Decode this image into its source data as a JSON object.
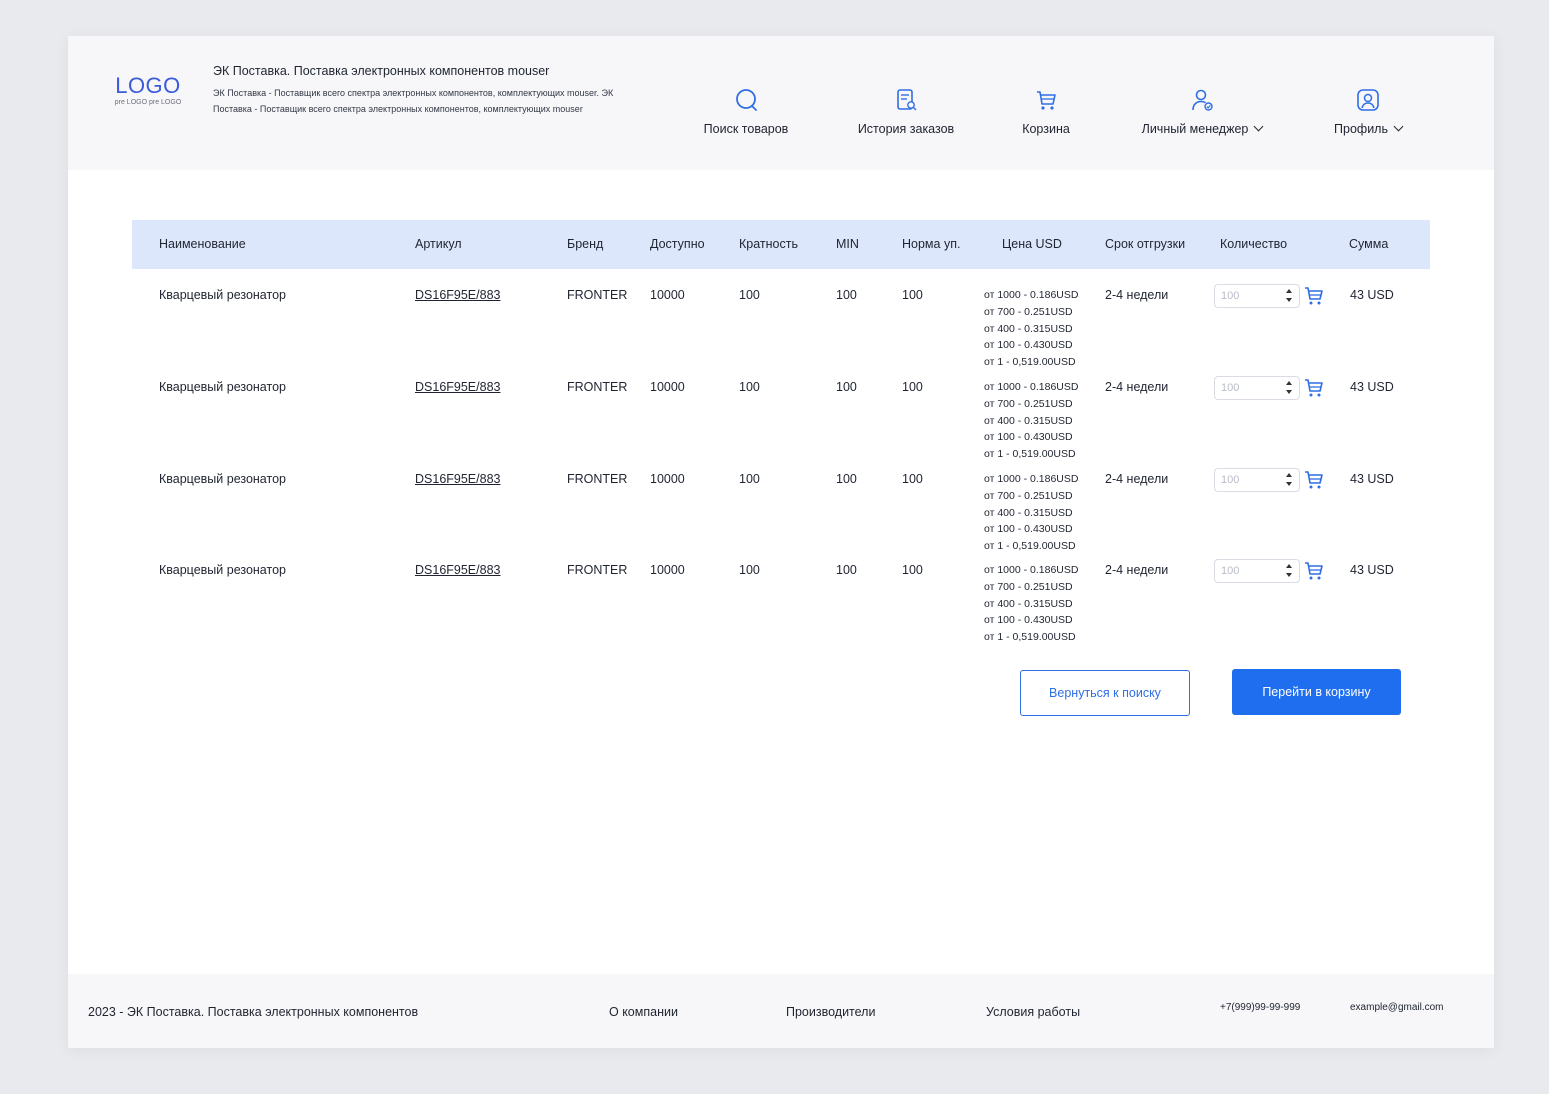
{
  "header": {
    "logo": "LOGO",
    "logo_sub": "pre LOGO pre LOGO",
    "title": "ЭК Поставка. Поставка электронных компонентов mouser",
    "description": "ЭК Поставка - Поставщик всего спектра электронных компонентов, комплектующих mouser. ЭК Поставка - Поставщик всего спектра электронных компонентов, комплектующих mouser"
  },
  "nav": {
    "search": "Поиск товаров",
    "history": "История заказов",
    "cart": "Корзина",
    "manager": "Личный менеджер",
    "profile": "Профиль"
  },
  "accent_color": "#1f6ef0",
  "table_header_color": "#dde7fb",
  "table": {
    "columns": [
      "Наименование",
      "Артикул",
      "Бренд",
      "Доступно",
      "Кратность",
      "MIN",
      "Норма уп.",
      "Цена USD",
      "Срок отгрузки",
      "Количество",
      "Сумма"
    ],
    "rows": [
      {
        "name": "Кварцевый резонатор",
        "sku": "DS16F95E/883",
        "brand": "FRONTER",
        "available": "10000",
        "multiplicity": "100",
        "min": "100",
        "pack": "100",
        "prices": [
          "от 1000 - 0.186USD",
          "от 700 - 0.251USD",
          "от 400 - 0.315USD",
          "от 100 - 0.430USD",
          "от 1 - 0,519.00USD"
        ],
        "lead_time": "2-4 недели",
        "quantity_placeholder": "100",
        "sum": "43 USD"
      },
      {
        "name": "Кварцевый резонатор",
        "sku": "DS16F95E/883",
        "brand": "FRONTER",
        "available": "10000",
        "multiplicity": "100",
        "min": "100",
        "pack": "100",
        "prices": [
          "от 1000 - 0.186USD",
          "от 700 - 0.251USD",
          "от 400 - 0.315USD",
          "от 100 - 0.430USD",
          "от 1 - 0,519.00USD"
        ],
        "lead_time": "2-4 недели",
        "quantity_placeholder": "100",
        "sum": "43 USD"
      },
      {
        "name": "Кварцевый резонатор",
        "sku": "DS16F95E/883",
        "brand": "FRONTER",
        "available": "10000",
        "multiplicity": "100",
        "min": "100",
        "pack": "100",
        "prices": [
          "от 1000 - 0.186USD",
          "от 700 - 0.251USD",
          "от 400 - 0.315USD",
          "от 100 - 0.430USD",
          "от 1 - 0,519.00USD"
        ],
        "lead_time": "2-4 недели",
        "quantity_placeholder": "100",
        "sum": "43 USD"
      },
      {
        "name": "Кварцевый резонатор",
        "sku": "DS16F95E/883",
        "brand": "FRONTER",
        "available": "10000",
        "multiplicity": "100",
        "min": "100",
        "pack": "100",
        "prices": [
          "от 1000 - 0.186USD",
          "от 700 - 0.251USD",
          "от 400 - 0.315USD",
          "от 100 - 0.430USD",
          "от 1 - 0,519.00USD"
        ],
        "lead_time": "2-4 недели",
        "quantity_placeholder": "100",
        "sum": "43 USD"
      }
    ]
  },
  "actions": {
    "back": "Вернуться к поиску",
    "to_cart": "Перейти в корзину"
  },
  "footer": {
    "copyright": "2023 - ЭК Поставка. Поставка электронных компонентов",
    "about": "О компании",
    "manufacturers": "Производители",
    "terms": "Условия работы",
    "phone": "+7(999)99-99-999",
    "email": "example@gmail.com"
  }
}
